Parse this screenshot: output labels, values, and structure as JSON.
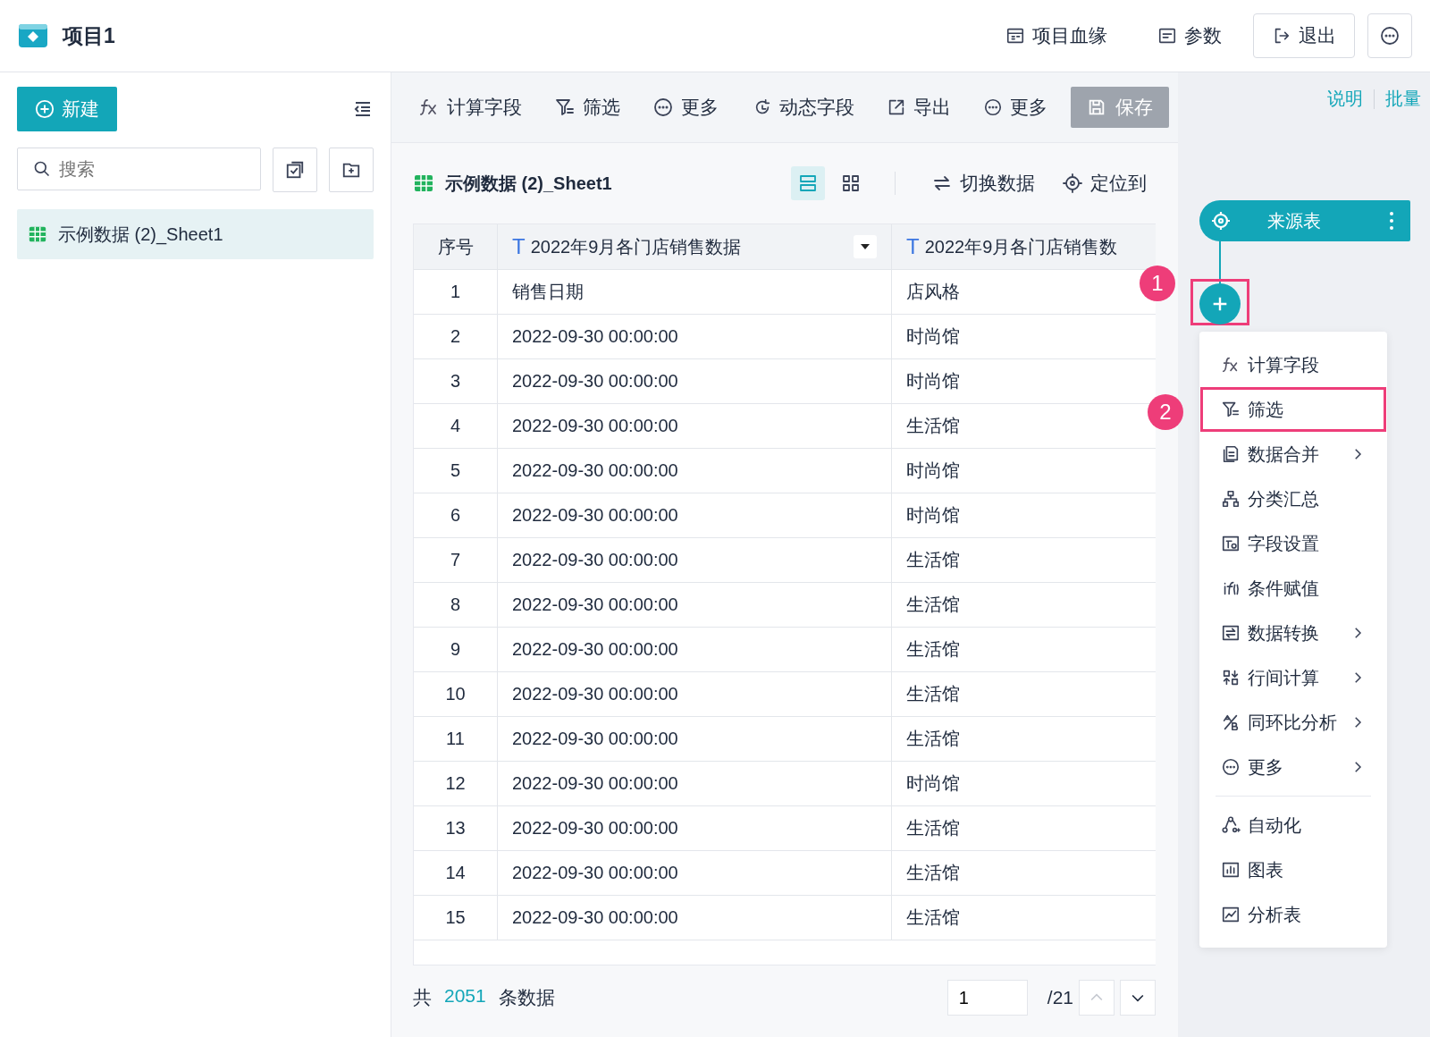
{
  "app": {
    "title": "项目1"
  },
  "header_actions": [
    {
      "kind": "lineage",
      "label": "项目血缘",
      "outlined": false
    },
    {
      "kind": "params",
      "label": "参数",
      "outlined": false
    },
    {
      "kind": "exit",
      "label": "退出",
      "outlined": true
    }
  ],
  "sidebar": {
    "new_button": "新建",
    "search": {
      "placeholder": "搜索"
    },
    "items": [
      {
        "label": "示例数据 (2)_Sheet1",
        "selected": true
      }
    ]
  },
  "toolbar": {
    "left": [
      {
        "kind": "fx",
        "label": "计算字段"
      },
      {
        "kind": "filter",
        "label": "筛选"
      },
      {
        "kind": "more",
        "label": "更多"
      }
    ],
    "right": [
      {
        "kind": "dynamic",
        "label": "动态字段"
      },
      {
        "kind": "export",
        "label": "导出"
      },
      {
        "kind": "more",
        "label": "更多"
      }
    ],
    "save": {
      "label": "保存",
      "disabled": true
    }
  },
  "table_panel": {
    "title": "示例数据 (2)_Sheet1",
    "view_modes": [
      {
        "kind": "rows",
        "selected": true
      },
      {
        "kind": "grid",
        "selected": false
      }
    ],
    "actions": [
      {
        "kind": "switch",
        "label": "切换数据"
      },
      {
        "kind": "locate",
        "label": "定位到"
      }
    ]
  },
  "table": {
    "columns": [
      {
        "label": "序号"
      },
      {
        "label": "2022年9月各门店销售数据",
        "type_mark": "T",
        "dropdown": true
      },
      {
        "label": "2022年9月各门店销售数",
        "type_mark": "T"
      }
    ],
    "rows": [
      [
        "1",
        "销售日期",
        "店风格"
      ],
      [
        "2",
        "2022-09-30 00:00:00",
        "时尚馆"
      ],
      [
        "3",
        "2022-09-30 00:00:00",
        "时尚馆"
      ],
      [
        "4",
        "2022-09-30 00:00:00",
        "生活馆"
      ],
      [
        "5",
        "2022-09-30 00:00:00",
        "时尚馆"
      ],
      [
        "6",
        "2022-09-30 00:00:00",
        "时尚馆"
      ],
      [
        "7",
        "2022-09-30 00:00:00",
        "生活馆"
      ],
      [
        "8",
        "2022-09-30 00:00:00",
        "生活馆"
      ],
      [
        "9",
        "2022-09-30 00:00:00",
        "生活馆"
      ],
      [
        "10",
        "2022-09-30 00:00:00",
        "生活馆"
      ],
      [
        "11",
        "2022-09-30 00:00:00",
        "生活馆"
      ],
      [
        "12",
        "2022-09-30 00:00:00",
        "时尚馆"
      ],
      [
        "13",
        "2022-09-30 00:00:00",
        "生活馆"
      ],
      [
        "14",
        "2022-09-30 00:00:00",
        "生活馆"
      ],
      [
        "15",
        "2022-09-30 00:00:00",
        "生活馆"
      ]
    ]
  },
  "footer": {
    "prefix": "共",
    "count": "2051",
    "suffix": "条数据",
    "page": "1",
    "total": "/21",
    "prev_disabled": true,
    "next_disabled": false
  },
  "flow_panel": {
    "links": [
      "说明",
      "批量"
    ],
    "node": {
      "label": "来源表"
    },
    "add_annotation": "1",
    "menu_sections": [
      {
        "items": [
          {
            "kind": "fx",
            "label": "计算字段",
            "submenu": false,
            "highlighted": false
          },
          {
            "kind": "filter",
            "label": "筛选",
            "submenu": false,
            "highlighted": true,
            "annotation": "2"
          },
          {
            "kind": "merge",
            "label": "数据合并",
            "submenu": true,
            "highlighted": false
          },
          {
            "kind": "group",
            "label": "分类汇总",
            "submenu": false,
            "highlighted": false
          },
          {
            "kind": "fieldset",
            "label": "字段设置",
            "submenu": false,
            "highlighted": false
          },
          {
            "kind": "if",
            "label": "条件赋值",
            "submenu": false,
            "highlighted": false
          },
          {
            "kind": "convert",
            "label": "数据转换",
            "submenu": true,
            "highlighted": false
          },
          {
            "kind": "rowcalc",
            "label": "行间计算",
            "submenu": true,
            "highlighted": false
          },
          {
            "kind": "ratio",
            "label": "同环比分析",
            "submenu": true,
            "highlighted": false
          },
          {
            "kind": "more",
            "label": "更多",
            "submenu": true,
            "highlighted": false
          }
        ]
      },
      {
        "items": [
          {
            "kind": "auto",
            "label": "自动化",
            "submenu": false,
            "highlighted": false
          },
          {
            "kind": "chart",
            "label": "图表",
            "submenu": false,
            "highlighted": false
          },
          {
            "kind": "analysis",
            "label": "分析表",
            "submenu": false,
            "highlighted": false
          }
        ]
      }
    ]
  }
}
